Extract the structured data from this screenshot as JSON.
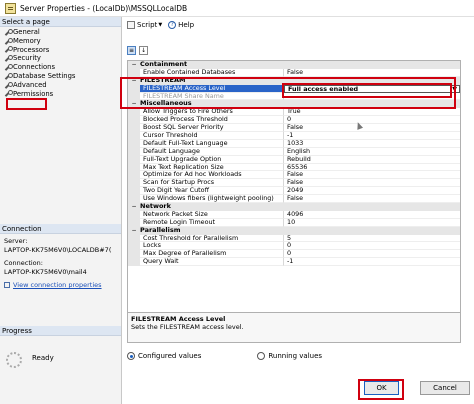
{
  "window": {
    "title": "Server Properties - (LocalDb)\\MSSQLLocalDB"
  },
  "left_pane": {
    "select_page_header": "Select a page",
    "pages": [
      {
        "label": "General"
      },
      {
        "label": "Memory"
      },
      {
        "label": "Processors"
      },
      {
        "label": "Security"
      },
      {
        "label": "Connections"
      },
      {
        "label": "Database Settings"
      },
      {
        "label": "Advanced"
      },
      {
        "label": "Permissions"
      }
    ],
    "connection_header": "Connection",
    "server_label": "Server:",
    "server_value": "LAPTOP-KK75M6V0\\LOCALDB#7(",
    "connection_label": "Connection:",
    "connection_value": "LAPTOP-KK75M6V0\\mail4",
    "view_link": "View connection properties",
    "progress_header": "Progress",
    "progress_status": "Ready"
  },
  "toolbar": {
    "script_label": "Script",
    "help_label": "Help"
  },
  "grid": {
    "rows": [
      {
        "kind": "cat",
        "label": "Containment",
        "exp": "−"
      },
      {
        "kind": "row",
        "name": "Enable Contained Databases",
        "value": "False"
      },
      {
        "kind": "cat",
        "label": "FILESTREAM",
        "exp": "−"
      },
      {
        "kind": "row",
        "name": "FILESTREAM Access Level",
        "value": "Full access enabled",
        "sel": true
      },
      {
        "kind": "row",
        "name": "FILESTREAM Share Name",
        "value": "",
        "dis": true
      },
      {
        "kind": "cat",
        "label": "Miscellaneous",
        "exp": "−"
      },
      {
        "kind": "row",
        "name": "Allow Triggers to Fire Others",
        "value": "True"
      },
      {
        "kind": "row",
        "name": "Blocked Process Threshold",
        "value": "0"
      },
      {
        "kind": "row",
        "name": "Boost SQL Server Priority",
        "value": "False"
      },
      {
        "kind": "row",
        "name": "Cursor Threshold",
        "value": "-1"
      },
      {
        "kind": "row",
        "name": "Default Full-Text Language",
        "value": "1033"
      },
      {
        "kind": "row",
        "name": "Default Language",
        "value": "English"
      },
      {
        "kind": "row",
        "name": "Full-Text Upgrade Option",
        "value": "Rebuild"
      },
      {
        "kind": "row",
        "name": "Max Text Replication Size",
        "value": "65536"
      },
      {
        "kind": "row",
        "name": "Optimize for Ad hoc Workloads",
        "value": "False"
      },
      {
        "kind": "row",
        "name": "Scan for Startup Procs",
        "value": "False"
      },
      {
        "kind": "row",
        "name": "Two Digit Year Cutoff",
        "value": "2049"
      },
      {
        "kind": "row",
        "name": "Use Windows fibers (lightweight pooling)",
        "value": "False"
      },
      {
        "kind": "cat",
        "label": "Network",
        "exp": "−"
      },
      {
        "kind": "row",
        "name": "Network Packet Size",
        "value": "4096"
      },
      {
        "kind": "row",
        "name": "Remote Login Timeout",
        "value": "10"
      },
      {
        "kind": "cat",
        "label": "Parallelism",
        "exp": "−"
      },
      {
        "kind": "row",
        "name": "Cost Threshold for Parallelism",
        "value": "5"
      },
      {
        "kind": "row",
        "name": "Locks",
        "value": "0"
      },
      {
        "kind": "row",
        "name": "Max Degree of Parallelism",
        "value": "0"
      },
      {
        "kind": "row",
        "name": "Query Wait",
        "value": "-1"
      }
    ]
  },
  "description": {
    "title": "FILESTREAM Access Level",
    "text": "Sets the FILESTREAM access level."
  },
  "radios": {
    "configured": "Configured values",
    "running": "Running values"
  },
  "buttons": {
    "ok": "OK",
    "cancel": "Cancel"
  },
  "icons": {
    "dropdown": "chevron-down-icon",
    "sort_categorized": "categorized-icon",
    "sort_alpha": "alphabetical-icon"
  },
  "colors": {
    "highlight": "#d0000f",
    "selection": "#2a64c8"
  }
}
